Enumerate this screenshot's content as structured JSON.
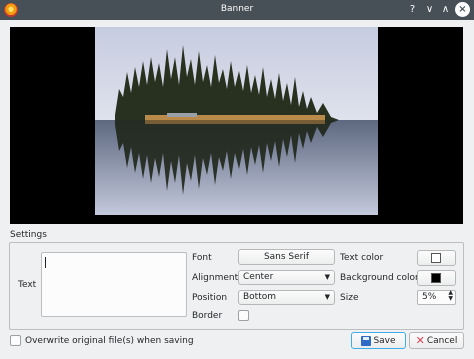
{
  "window": {
    "title": "Banner",
    "controls": {
      "help": "?",
      "minimize": "∨",
      "maximize": "∧",
      "close": "×"
    }
  },
  "settings": {
    "group_label": "Settings",
    "text_label": "Text",
    "text_value": "",
    "font_label": "Font",
    "font_button": "Sans Serif",
    "alignment_label": "Alignment",
    "alignment_value": "Center",
    "position_label": "Position",
    "position_value": "Bottom",
    "border_label": "Border",
    "border_checked": false,
    "text_color_label": "Text color",
    "text_color": "#ffffff",
    "background_color_label": "Background color",
    "background_color": "#000000",
    "size_label": "Size",
    "size_value": "5%"
  },
  "footer": {
    "overwrite_label": "Overwrite original file(s) when saving",
    "overwrite_checked": false,
    "save_label": "Save",
    "cancel_label": "Cancel"
  },
  "colors": {
    "accent": "#3daee9",
    "titlebar": "#475057",
    "background": "#eff0f1"
  }
}
